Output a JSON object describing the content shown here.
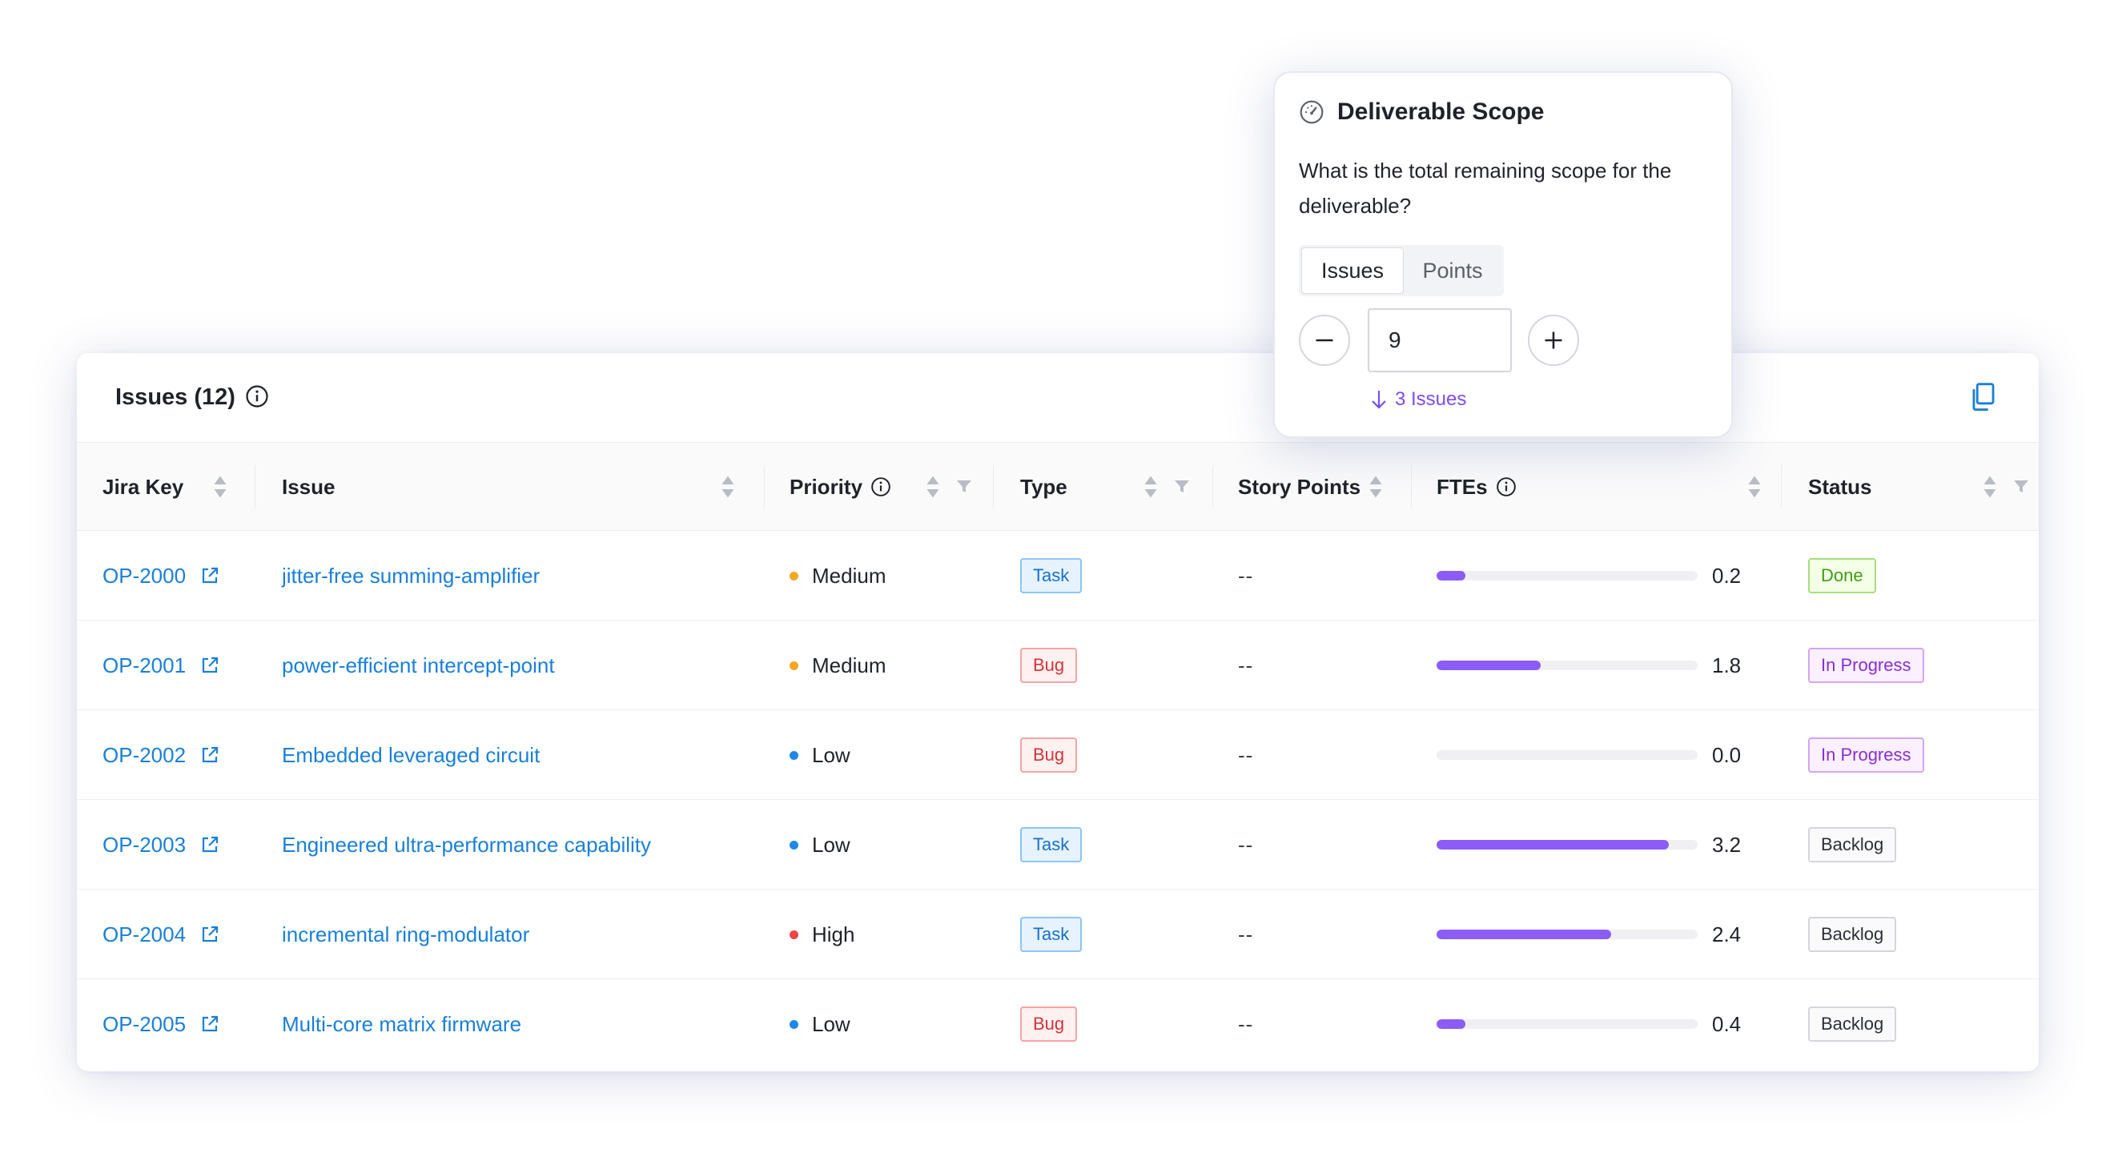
{
  "issues_table": {
    "title": "Issues (12)",
    "columns": {
      "jira_key": "Jira Key",
      "issue": "Issue",
      "priority": "Priority",
      "type": "Type",
      "story_points": "Story Points",
      "ftes": "FTEs",
      "status": "Status"
    },
    "rows": [
      {
        "key": "OP-2000",
        "issue": "jitter-free summing-amplifier",
        "priority": "Medium",
        "priority_color": "#f5a623",
        "type": "Task",
        "points": "--",
        "fte": "0.2",
        "fte_fraction": 0.11,
        "status": "Done"
      },
      {
        "key": "OP-2001",
        "issue": "power-efficient intercept-point",
        "priority": "Medium",
        "priority_color": "#f5a623",
        "type": "Bug",
        "points": "--",
        "fte": "1.8",
        "fte_fraction": 0.4,
        "status": "In Progress"
      },
      {
        "key": "OP-2002",
        "issue": "Embedded leveraged circuit",
        "priority": "Low",
        "priority_color": "#1e88e5",
        "type": "Bug",
        "points": "--",
        "fte": "0.0",
        "fte_fraction": 0.0,
        "status": "In Progress"
      },
      {
        "key": "OP-2003",
        "issue": "Engineered ultra-performance capability",
        "priority": "Low",
        "priority_color": "#1e88e5",
        "type": "Task",
        "points": "--",
        "fte": "3.2",
        "fte_fraction": 0.89,
        "status": "Backlog"
      },
      {
        "key": "OP-2004",
        "issue": "incremental ring-modulator",
        "priority": "High",
        "priority_color": "#ef4444",
        "type": "Task",
        "points": "--",
        "fte": "2.4",
        "fte_fraction": 0.67,
        "status": "Backlog"
      },
      {
        "key": "OP-2005",
        "issue": "Multi-core matrix firmware",
        "priority": "Low",
        "priority_color": "#1e88e5",
        "type": "Bug",
        "points": "--",
        "fte": "0.4",
        "fte_fraction": 0.11,
        "status": "Backlog"
      }
    ]
  },
  "popover": {
    "title": "Deliverable Scope",
    "question": "What is the total remaining scope for the deliverable?",
    "tabs": [
      "Issues",
      "Points"
    ],
    "active_tab": "Issues",
    "value": "9",
    "hint": "3 Issues"
  },
  "colors": {
    "link": "#1a7fd6",
    "accent_purple": "#8b5cf6"
  }
}
